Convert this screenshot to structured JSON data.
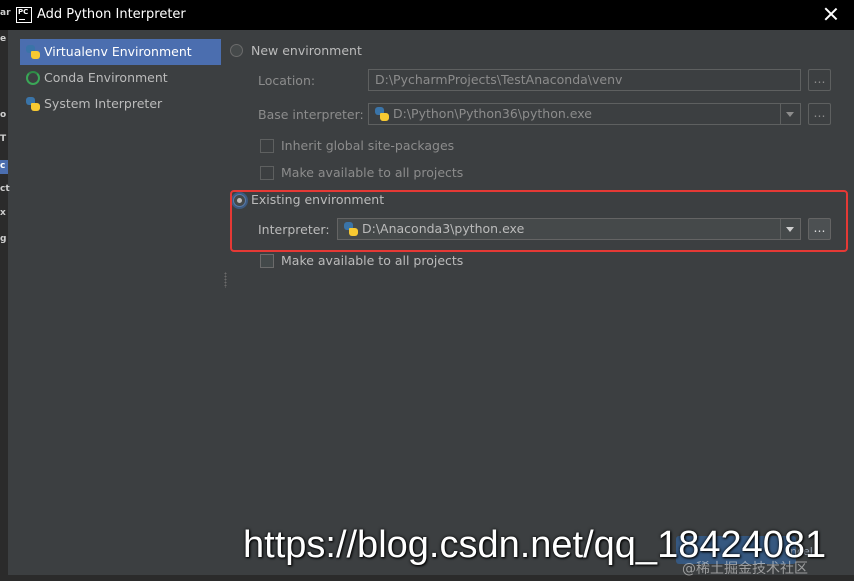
{
  "window": {
    "title": "Add Python Interpreter",
    "app_icon_text": "PC",
    "close_icon": "close-icon"
  },
  "left_strip_fragments": [
    "ar",
    "e",
    "o",
    "T",
    "c",
    "ct",
    "x",
    "g"
  ],
  "sidebar": {
    "items": [
      {
        "label": "Virtualenv Environment",
        "icon": "python-icon",
        "selected": true
      },
      {
        "label": "Conda Environment",
        "icon": "conda-icon",
        "selected": false
      },
      {
        "label": "System Interpreter",
        "icon": "python-icon",
        "selected": false
      }
    ]
  },
  "new_env": {
    "radio_label": "New environment",
    "checked": false,
    "location_label": "Location:",
    "location_value": "D:\\PycharmProjects\\TestAnaconda\\venv",
    "base_label": "Base interpreter:",
    "base_value": "D:\\Python\\Python36\\python.exe",
    "browse_label": "...",
    "inherit_label": "Inherit global site-packages",
    "available_label": "Make available to all projects"
  },
  "existing_env": {
    "radio_label": "Existing environment",
    "checked": true,
    "interpreter_label": "Interpreter:",
    "interpreter_value": "D:\\Anaconda3\\python.exe",
    "browse_label": "...",
    "available_label": "Make available to all projects"
  },
  "colors": {
    "background": "#3c3f41",
    "selection": "#4b6eaf",
    "highlight_box": "#e53935"
  },
  "partial_button_text": "ncel",
  "watermark": {
    "url": "https://blog.csdn.net/qq_18424081",
    "sub": "@稀土掘金技术社区"
  }
}
